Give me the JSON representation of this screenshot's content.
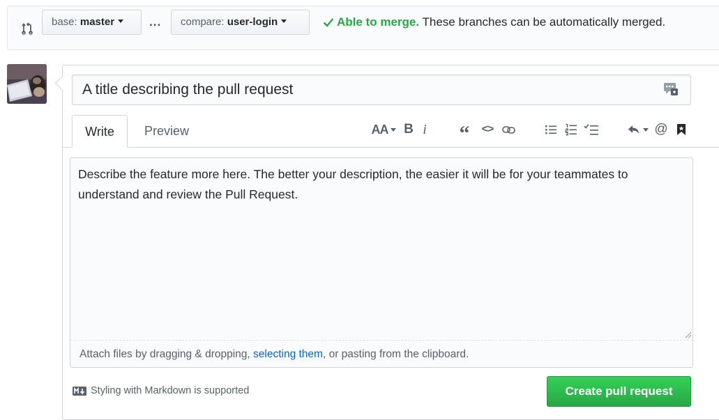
{
  "range": {
    "base_prefix": "base: ",
    "base_branch": "master",
    "separator": "...",
    "compare_prefix": "compare: ",
    "compare_branch": "user-login",
    "merge_ok": "Able to merge.",
    "merge_text": " These branches can be automatically merged."
  },
  "form": {
    "title_value": "A title describing the pull request",
    "tabs": [
      "Write",
      "Preview"
    ],
    "toolbar": {
      "header": "AA",
      "bold": "B",
      "italic": "i",
      "quote": "“",
      "code": "<>",
      "mention": "@"
    },
    "body_value": "Describe the feature more here. The better your description, the easier it will be for your teammates to understand and review the Pull Request.",
    "attach_before": "Attach files by dragging & dropping, ",
    "attach_link": "selecting them",
    "attach_after": ", or pasting from the clipboard.",
    "markdown_note": "Styling with Markdown is supported",
    "submit_label": "Create pull request"
  },
  "icons": {
    "compare": "git-compare-icon",
    "check": "check-icon",
    "saved_replies": "saved-replies-icon",
    "link": "link-icon",
    "unordered_list": "unordered-list-icon",
    "ordered_list": "ordered-list-icon",
    "task_list": "task-list-icon",
    "reply": "reply-icon",
    "reference": "bookmark-icon",
    "markdown": "markdown-icon"
  },
  "colors": {
    "accent_green": "#28a745",
    "link_blue": "#0366d6",
    "muted": "#586069"
  }
}
